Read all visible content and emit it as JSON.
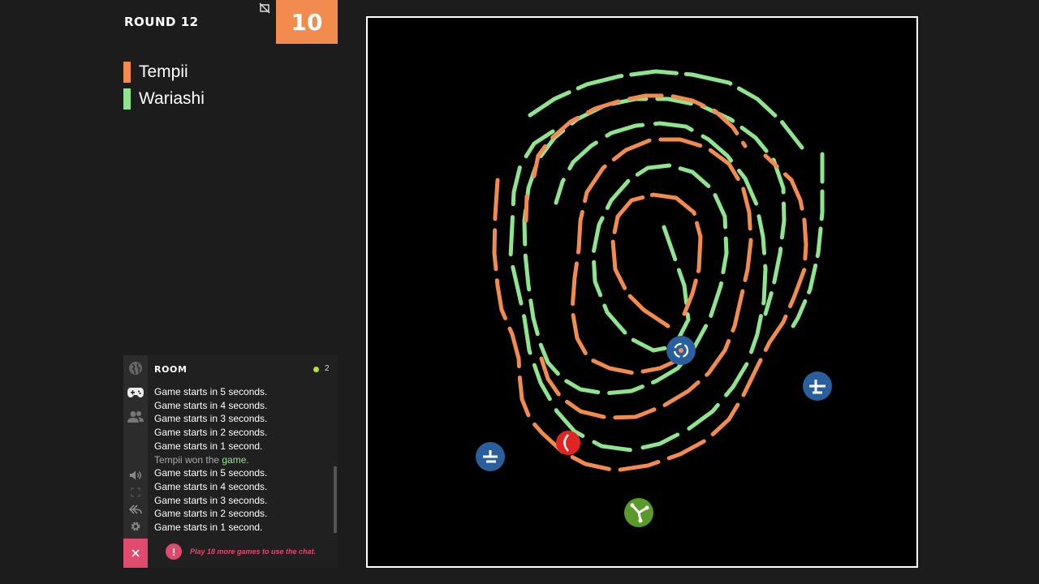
{
  "header": {
    "round_label": "ROUND 12",
    "score": "10",
    "score_color": "#f28c4e"
  },
  "players": [
    {
      "name": "Tempii",
      "color": "#f28c4e"
    },
    {
      "name": "Wariashi",
      "color": "#8fe48f"
    }
  ],
  "room": {
    "title": "ROOM",
    "online_count": "2",
    "sidebar_icons": [
      "globe-icon",
      "gamepad-icon",
      "users-icon",
      "volume-icon",
      "fullscreen-icon",
      "reply-icon",
      "gear-icon",
      "close-icon"
    ],
    "messages": [
      {
        "text": "Game starts in 5 seconds."
      },
      {
        "text": "Game starts in 4 seconds."
      },
      {
        "text": "Game starts in 3 seconds."
      },
      {
        "text": "Game starts in 2 seconds."
      },
      {
        "text": "Game starts in 1 second."
      },
      {
        "prefix": "Tempii won the ",
        "highlight": "game",
        "suffix": "."
      },
      {
        "text": "Game starts in 5 seconds."
      },
      {
        "text": "Game starts in 4 seconds."
      },
      {
        "text": "Game starts in 3 seconds."
      },
      {
        "text": "Game starts in 2 seconds."
      },
      {
        "text": "Game starts in 1 second."
      }
    ],
    "chat_notice": "Play 18 more games to use the chat."
  },
  "arena": {
    "background": "#000000",
    "powerups": [
      {
        "name": "blue-powerup-left",
        "color": "#2a5f9e"
      },
      {
        "name": "blue-powerup-center",
        "color": "#2a5f9e"
      },
      {
        "name": "blue-powerup-right",
        "color": "#2a5f9e"
      },
      {
        "name": "green-powerup-bottom",
        "color": "#5a9a2a"
      }
    ]
  }
}
